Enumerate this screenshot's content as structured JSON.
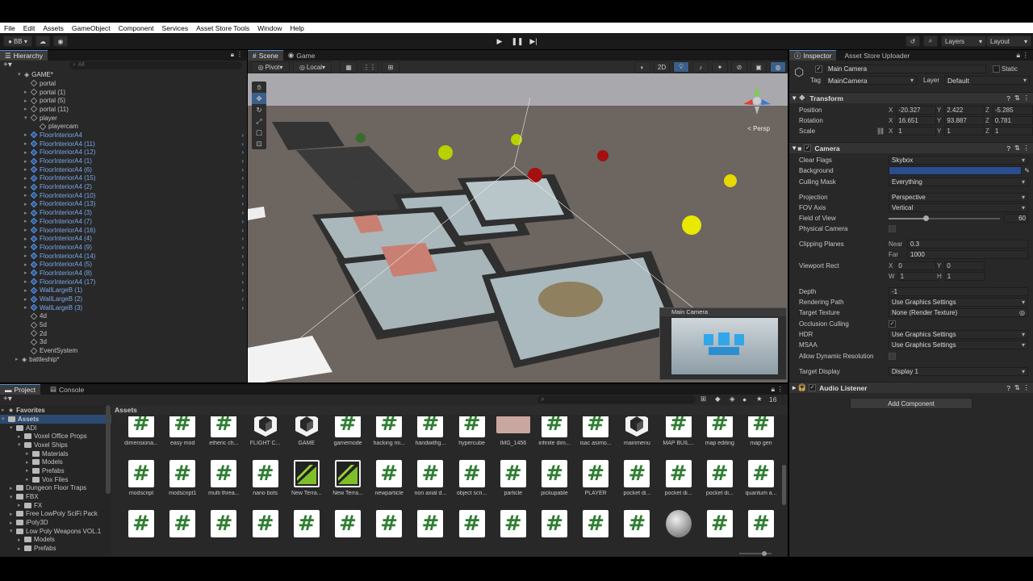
{
  "menubar": [
    "File",
    "Edit",
    "Assets",
    "GameObject",
    "Component",
    "Services",
    "Asset Store Tools",
    "Window",
    "Help"
  ],
  "toolbar": {
    "account": "BB ▾",
    "layers": "Layers",
    "layout": "Layout"
  },
  "hierarchy": {
    "tab": "Hierarchy",
    "search_placeholder": "All",
    "scene": "GAME*",
    "items": [
      {
        "label": "portal",
        "indent": 2,
        "blue": false,
        "arrow": false
      },
      {
        "label": "portal (1)",
        "indent": 2,
        "blue": false,
        "arrow": true
      },
      {
        "label": "portal (5)",
        "indent": 2,
        "blue": false,
        "arrow": true
      },
      {
        "label": "portal (11)",
        "indent": 2,
        "blue": false,
        "arrow": true
      },
      {
        "label": "player",
        "indent": 2,
        "blue": false,
        "arrow": true,
        "open": true
      },
      {
        "label": "playercam",
        "indent": 3,
        "blue": false,
        "arrow": false
      },
      {
        "label": "FloorInteriorA4",
        "indent": 2,
        "blue": true,
        "arrow": true
      },
      {
        "label": "FloorInteriorA4 (11)",
        "indent": 2,
        "blue": true,
        "arrow": true
      },
      {
        "label": "FloorInteriorA4 (12)",
        "indent": 2,
        "blue": true,
        "arrow": true
      },
      {
        "label": "FloorInteriorA4 (1)",
        "indent": 2,
        "blue": true,
        "arrow": true
      },
      {
        "label": "FloorInteriorA4 (6)",
        "indent": 2,
        "blue": true,
        "arrow": true
      },
      {
        "label": "FloorInteriorA4 (15)",
        "indent": 2,
        "blue": true,
        "arrow": true
      },
      {
        "label": "FloorInteriorA4 (2)",
        "indent": 2,
        "blue": true,
        "arrow": true
      },
      {
        "label": "FloorInteriorA4 (10)",
        "indent": 2,
        "blue": true,
        "arrow": true
      },
      {
        "label": "FloorInteriorA4 (13)",
        "indent": 2,
        "blue": true,
        "arrow": true
      },
      {
        "label": "FloorInteriorA4 (3)",
        "indent": 2,
        "blue": true,
        "arrow": true
      },
      {
        "label": "FloorInteriorA4 (7)",
        "indent": 2,
        "blue": true,
        "arrow": true
      },
      {
        "label": "FloorInteriorA4 (16)",
        "indent": 2,
        "blue": true,
        "arrow": true
      },
      {
        "label": "FloorInteriorA4 (4)",
        "indent": 2,
        "blue": true,
        "arrow": true
      },
      {
        "label": "FloorInteriorA4 (9)",
        "indent": 2,
        "blue": true,
        "arrow": true
      },
      {
        "label": "FloorInteriorA4 (14)",
        "indent": 2,
        "blue": true,
        "arrow": true
      },
      {
        "label": "FloorInteriorA4 (5)",
        "indent": 2,
        "blue": true,
        "arrow": true
      },
      {
        "label": "FloorInteriorA4 (8)",
        "indent": 2,
        "blue": true,
        "arrow": true
      },
      {
        "label": "FloorInteriorA4 (17)",
        "indent": 2,
        "blue": true,
        "arrow": true
      },
      {
        "label": "WallLargeB (1)",
        "indent": 2,
        "blue": true,
        "arrow": true
      },
      {
        "label": "WallLargeB (2)",
        "indent": 2,
        "blue": true,
        "arrow": true
      },
      {
        "label": "WallLargeB (3)",
        "indent": 2,
        "blue": true,
        "arrow": true
      },
      {
        "label": "4d",
        "indent": 2,
        "blue": false,
        "arrow": false
      },
      {
        "label": "5d",
        "indent": 2,
        "blue": false,
        "arrow": false
      },
      {
        "label": "2d",
        "indent": 2,
        "blue": false,
        "arrow": false
      },
      {
        "label": "3d",
        "indent": 2,
        "blue": false,
        "arrow": false
      },
      {
        "label": "EventSystem",
        "indent": 2,
        "blue": false,
        "arrow": false
      },
      {
        "label": "battleship*",
        "indent": 1,
        "blue": false,
        "arrow": true,
        "scene": true
      }
    ]
  },
  "scene_view": {
    "tabs": [
      "Scene",
      "Game"
    ],
    "pivot": "Pivot",
    "local": "Local",
    "mode_2d": "2D",
    "persp_label": "< Persp",
    "camera_preview_title": "Main Camera"
  },
  "inspector": {
    "tabs": [
      "Inspector",
      "Asset Store Uploader"
    ],
    "object_name": "Main Camera",
    "static_label": "Static",
    "tag_label": "Tag",
    "tag_value": "MainCamera",
    "layer_label": "Layer",
    "layer_value": "Default",
    "transform": {
      "title": "Transform",
      "position_label": "Position",
      "position": {
        "x": "-20.327",
        "y": "2.422",
        "z": "-5.285"
      },
      "rotation_label": "Rotation",
      "rotation": {
        "x": "16.651",
        "y": "93.887",
        "z": "0.781"
      },
      "scale_label": "Scale",
      "scale": {
        "x": "1",
        "y": "1",
        "z": "1"
      }
    },
    "camera": {
      "title": "Camera",
      "clear_flags_label": "Clear Flags",
      "clear_flags": "Skybox",
      "background_label": "Background",
      "background_color": "#2a4d8f",
      "culling_mask_label": "Culling Mask",
      "culling_mask": "Everything",
      "projection_label": "Projection",
      "projection": "Perspective",
      "fov_axis_label": "FOV Axis",
      "fov_axis": "Vertical",
      "fov_label": "Field of View",
      "fov": "60",
      "fov_slider_fraction": 0.33,
      "physical_label": "Physical Camera",
      "clipping_label": "Clipping Planes",
      "near_label": "Near",
      "near": "0.3",
      "far_label": "Far",
      "far": "1000",
      "viewport_label": "Viewport Rect",
      "vx": "0",
      "vy": "0",
      "vw": "1",
      "vh": "1",
      "depth_label": "Depth",
      "depth": "-1",
      "rendering_path_label": "Rendering Path",
      "rendering_path": "Use Graphics Settings",
      "target_texture_label": "Target Texture",
      "target_texture": "None (Render Texture)",
      "occlusion_label": "Occlusion Culling",
      "hdr_label": "HDR",
      "hdr": "Use Graphics Settings",
      "msaa_label": "MSAA",
      "msaa": "Use Graphics Settings",
      "dyn_res_label": "Allow Dynamic Resolution",
      "target_display_label": "Target Display",
      "target_display": "Display 1"
    },
    "audio_listener": "Audio Listener",
    "add_component": "Add Component"
  },
  "project": {
    "tabs": [
      "Project",
      "Console"
    ],
    "favorites": "Favorites",
    "breadcrumb": "Assets",
    "count_badge": "16",
    "tree": [
      {
        "label": "Assets",
        "indent": 0,
        "open": true
      },
      {
        "label": "ADI",
        "indent": 1,
        "open": true
      },
      {
        "label": "Voxel Office Props",
        "indent": 2
      },
      {
        "label": "Voxel Ships",
        "indent": 2,
        "open": true
      },
      {
        "label": "Materials",
        "indent": 3
      },
      {
        "label": "Models",
        "indent": 3
      },
      {
        "label": "Prefabs",
        "indent": 3
      },
      {
        "label": "Vox Files",
        "indent": 3
      },
      {
        "label": "Dungeon Floor Traps",
        "indent": 1
      },
      {
        "label": "FBX",
        "indent": 1,
        "open": true
      },
      {
        "label": "FX",
        "indent": 2
      },
      {
        "label": "Free LowPoly SciFi Pack",
        "indent": 1
      },
      {
        "label": "iPoly3D",
        "indent": 1
      },
      {
        "label": "Low Poly Weapons VOL.1",
        "indent": 1,
        "open": true
      },
      {
        "label": "Models",
        "indent": 2
      },
      {
        "label": "Prefabs",
        "indent": 2
      }
    ],
    "assets_row1": [
      {
        "name": "dimensiona...",
        "type": "script"
      },
      {
        "name": "easy mod",
        "type": "script"
      },
      {
        "name": "etheric ch...",
        "type": "script"
      },
      {
        "name": "FLIGHT C...",
        "type": "unity"
      },
      {
        "name": "GAME",
        "type": "unity"
      },
      {
        "name": "gamemode",
        "type": "script"
      },
      {
        "name": "hacking mi...",
        "type": "script"
      },
      {
        "name": "handwithg...",
        "type": "script"
      },
      {
        "name": "hypercube",
        "type": "script"
      },
      {
        "name": "IMG_1456",
        "type": "img"
      },
      {
        "name": "infinite dim...",
        "type": "script"
      },
      {
        "name": "isac asimo...",
        "type": "script"
      },
      {
        "name": "mainmenu",
        "type": "unity"
      },
      {
        "name": "MAP BUIL...",
        "type": "script"
      },
      {
        "name": "map editing",
        "type": "script"
      },
      {
        "name": "map gen",
        "type": "script"
      }
    ],
    "assets_row2": [
      {
        "name": "modscript",
        "type": "script"
      },
      {
        "name": "modscript1",
        "type": "script"
      },
      {
        "name": "multi threa...",
        "type": "script"
      },
      {
        "name": "nano bots",
        "type": "script"
      },
      {
        "name": "New Terra...",
        "type": "terrain"
      },
      {
        "name": "New Terra...",
        "type": "terrain"
      },
      {
        "name": "newparticle",
        "type": "script"
      },
      {
        "name": "non axial d...",
        "type": "script"
      },
      {
        "name": "object scri...",
        "type": "script"
      },
      {
        "name": "particle",
        "type": "script"
      },
      {
        "name": "pickupable",
        "type": "script"
      },
      {
        "name": "PLAYER",
        "type": "script"
      },
      {
        "name": "pocket di...",
        "type": "script"
      },
      {
        "name": "pocket di...",
        "type": "script"
      },
      {
        "name": "pocket di...",
        "type": "script"
      },
      {
        "name": "quantum a...",
        "type": "script"
      }
    ],
    "assets_row3": [
      {
        "name": "",
        "type": "script"
      },
      {
        "name": "",
        "type": "script"
      },
      {
        "name": "",
        "type": "script"
      },
      {
        "name": "",
        "type": "script"
      },
      {
        "name": "",
        "type": "script"
      },
      {
        "name": "",
        "type": "script"
      },
      {
        "name": "",
        "type": "script"
      },
      {
        "name": "",
        "type": "script"
      },
      {
        "name": "",
        "type": "script"
      },
      {
        "name": "",
        "type": "script"
      },
      {
        "name": "",
        "type": "script"
      },
      {
        "name": "",
        "type": "script"
      },
      {
        "name": "",
        "type": "script"
      },
      {
        "name": "",
        "type": "sphere"
      },
      {
        "name": "",
        "type": "script"
      },
      {
        "name": "",
        "type": "script"
      }
    ]
  },
  "colors": {
    "accent": "#4a90d9",
    "panel": "#282828",
    "dark": "#191919",
    "script_green": "#2f7d32"
  }
}
